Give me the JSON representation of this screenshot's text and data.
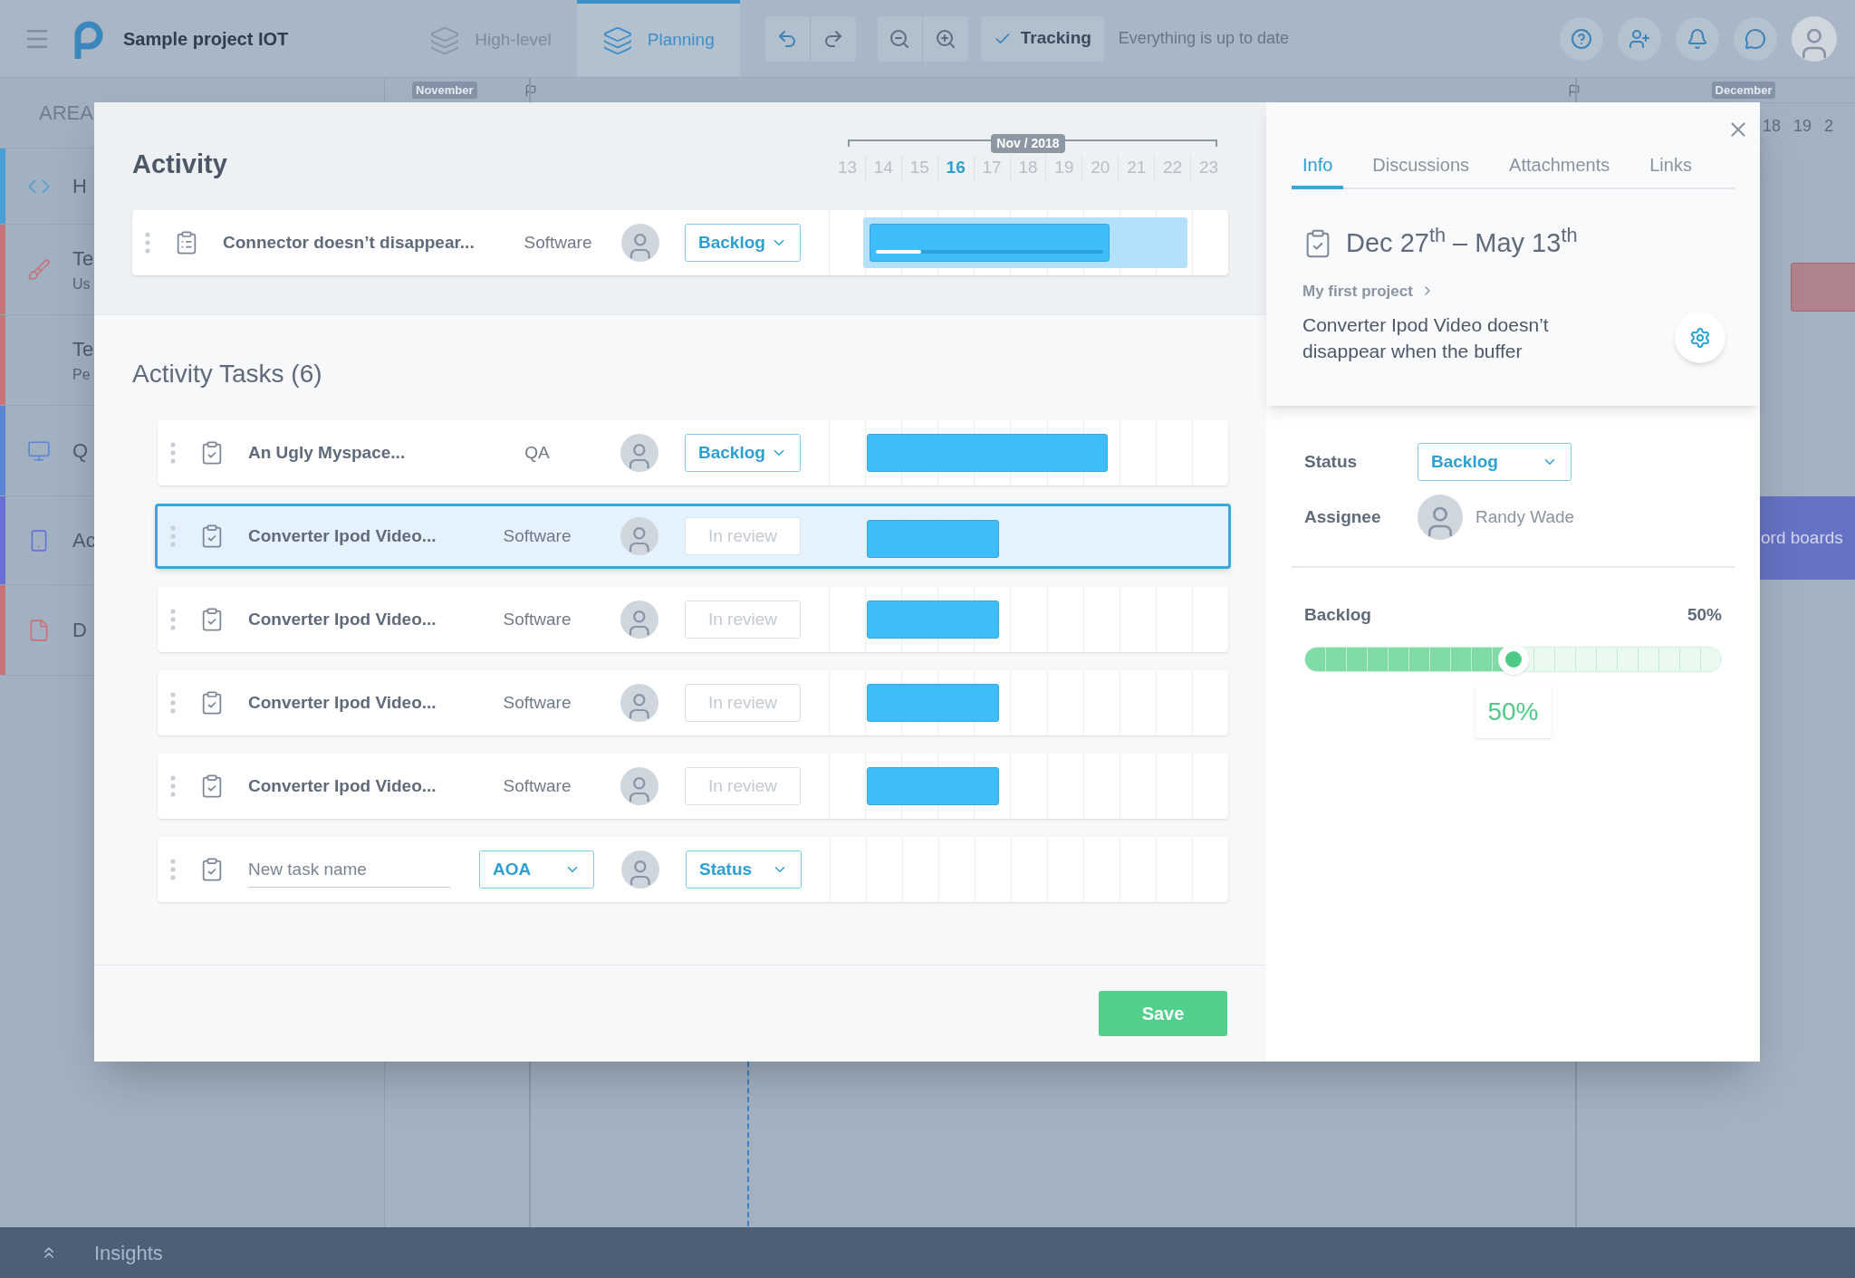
{
  "topbar": {
    "project": "Sample project IOT",
    "views": [
      {
        "label": "High-level",
        "selected": false
      },
      {
        "label": "Planning",
        "selected": true
      }
    ],
    "tracking": {
      "label": "Tracking",
      "checked": true
    },
    "sync_status": "Everything is up to date"
  },
  "background": {
    "area_header": "AREA",
    "sidebar": [
      {
        "title": "H",
        "color": "#4a9ed6"
      },
      {
        "title": "Te",
        "subtitle": "Us",
        "color": "#c9727a"
      },
      {
        "title": "Te",
        "subtitle": "Pe",
        "color": "#c9727a"
      },
      {
        "title": "Q",
        "color": "#5b86d6"
      },
      {
        "title": "Ac",
        "color": "#6a6fd8"
      },
      {
        "title": "D",
        "color": "#c9727a"
      }
    ],
    "months": [
      "November",
      "December"
    ],
    "days": [
      "18",
      "19",
      "2"
    ],
    "board_bar": "ord boards"
  },
  "activity": {
    "title": "Activity",
    "month": "Nov / 2018",
    "days": [
      {
        "label": "13",
        "selected": false
      },
      {
        "label": "14",
        "selected": false
      },
      {
        "label": "15",
        "selected": false
      },
      {
        "label": "16",
        "selected": true
      },
      {
        "label": "17",
        "selected": false
      },
      {
        "label": "18",
        "selected": false
      },
      {
        "label": "19",
        "selected": false
      },
      {
        "label": "20",
        "selected": false
      },
      {
        "label": "21",
        "selected": false
      },
      {
        "label": "22",
        "selected": false
      },
      {
        "label": "23",
        "selected": false
      }
    ],
    "task": {
      "name": "Connector doesn’t disappear...",
      "category": "Software",
      "status": "Backlog",
      "level": 0.2
    }
  },
  "tasks_title": "Activity Tasks (6)",
  "tasks": [
    {
      "name": "An Ugly Myspace...",
      "category": "QA",
      "status": {
        "label": "Backlog",
        "disabled": false
      },
      "selected": false
    },
    {
      "name": "Converter Ipod Video...",
      "category": "Software",
      "status": {
        "label": "In review",
        "disabled": true
      },
      "selected": true
    },
    {
      "name": "Converter Ipod Video...",
      "category": "Software",
      "status": {
        "label": "In review",
        "disabled": true
      },
      "selected": false
    },
    {
      "name": "Converter Ipod Video...",
      "category": "Software",
      "status": {
        "label": "In review",
        "disabled": true
      },
      "selected": false
    },
    {
      "name": "Converter Ipod Video...",
      "category": "Software",
      "status": {
        "label": "In review",
        "disabled": true
      },
      "selected": false
    }
  ],
  "new_task": {
    "placeholder": "New task name",
    "category": "AOA",
    "status": "Status"
  },
  "save": "Save",
  "details": {
    "tabs": [
      {
        "label": "Info",
        "selected": true
      },
      {
        "label": "Discussions",
        "selected": false
      },
      {
        "label": "Attachments",
        "selected": false
      },
      {
        "label": "Links",
        "selected": false
      }
    ],
    "dates": "Dec 27$^{th}$ – May 13$^{th}$",
    "project": "My first project",
    "title": "Converter Ipod Video doesn’t disappear when the buffer",
    "status_label": "Status",
    "status": "Backlog",
    "assignee_label": "Assignee",
    "assignee": "Randy Wade",
    "progress": {
      "label": "Backlog",
      "reading": "50%",
      "level": 0.5,
      "tooltip": "50%"
    }
  },
  "footer": {
    "label": "Insights"
  }
}
